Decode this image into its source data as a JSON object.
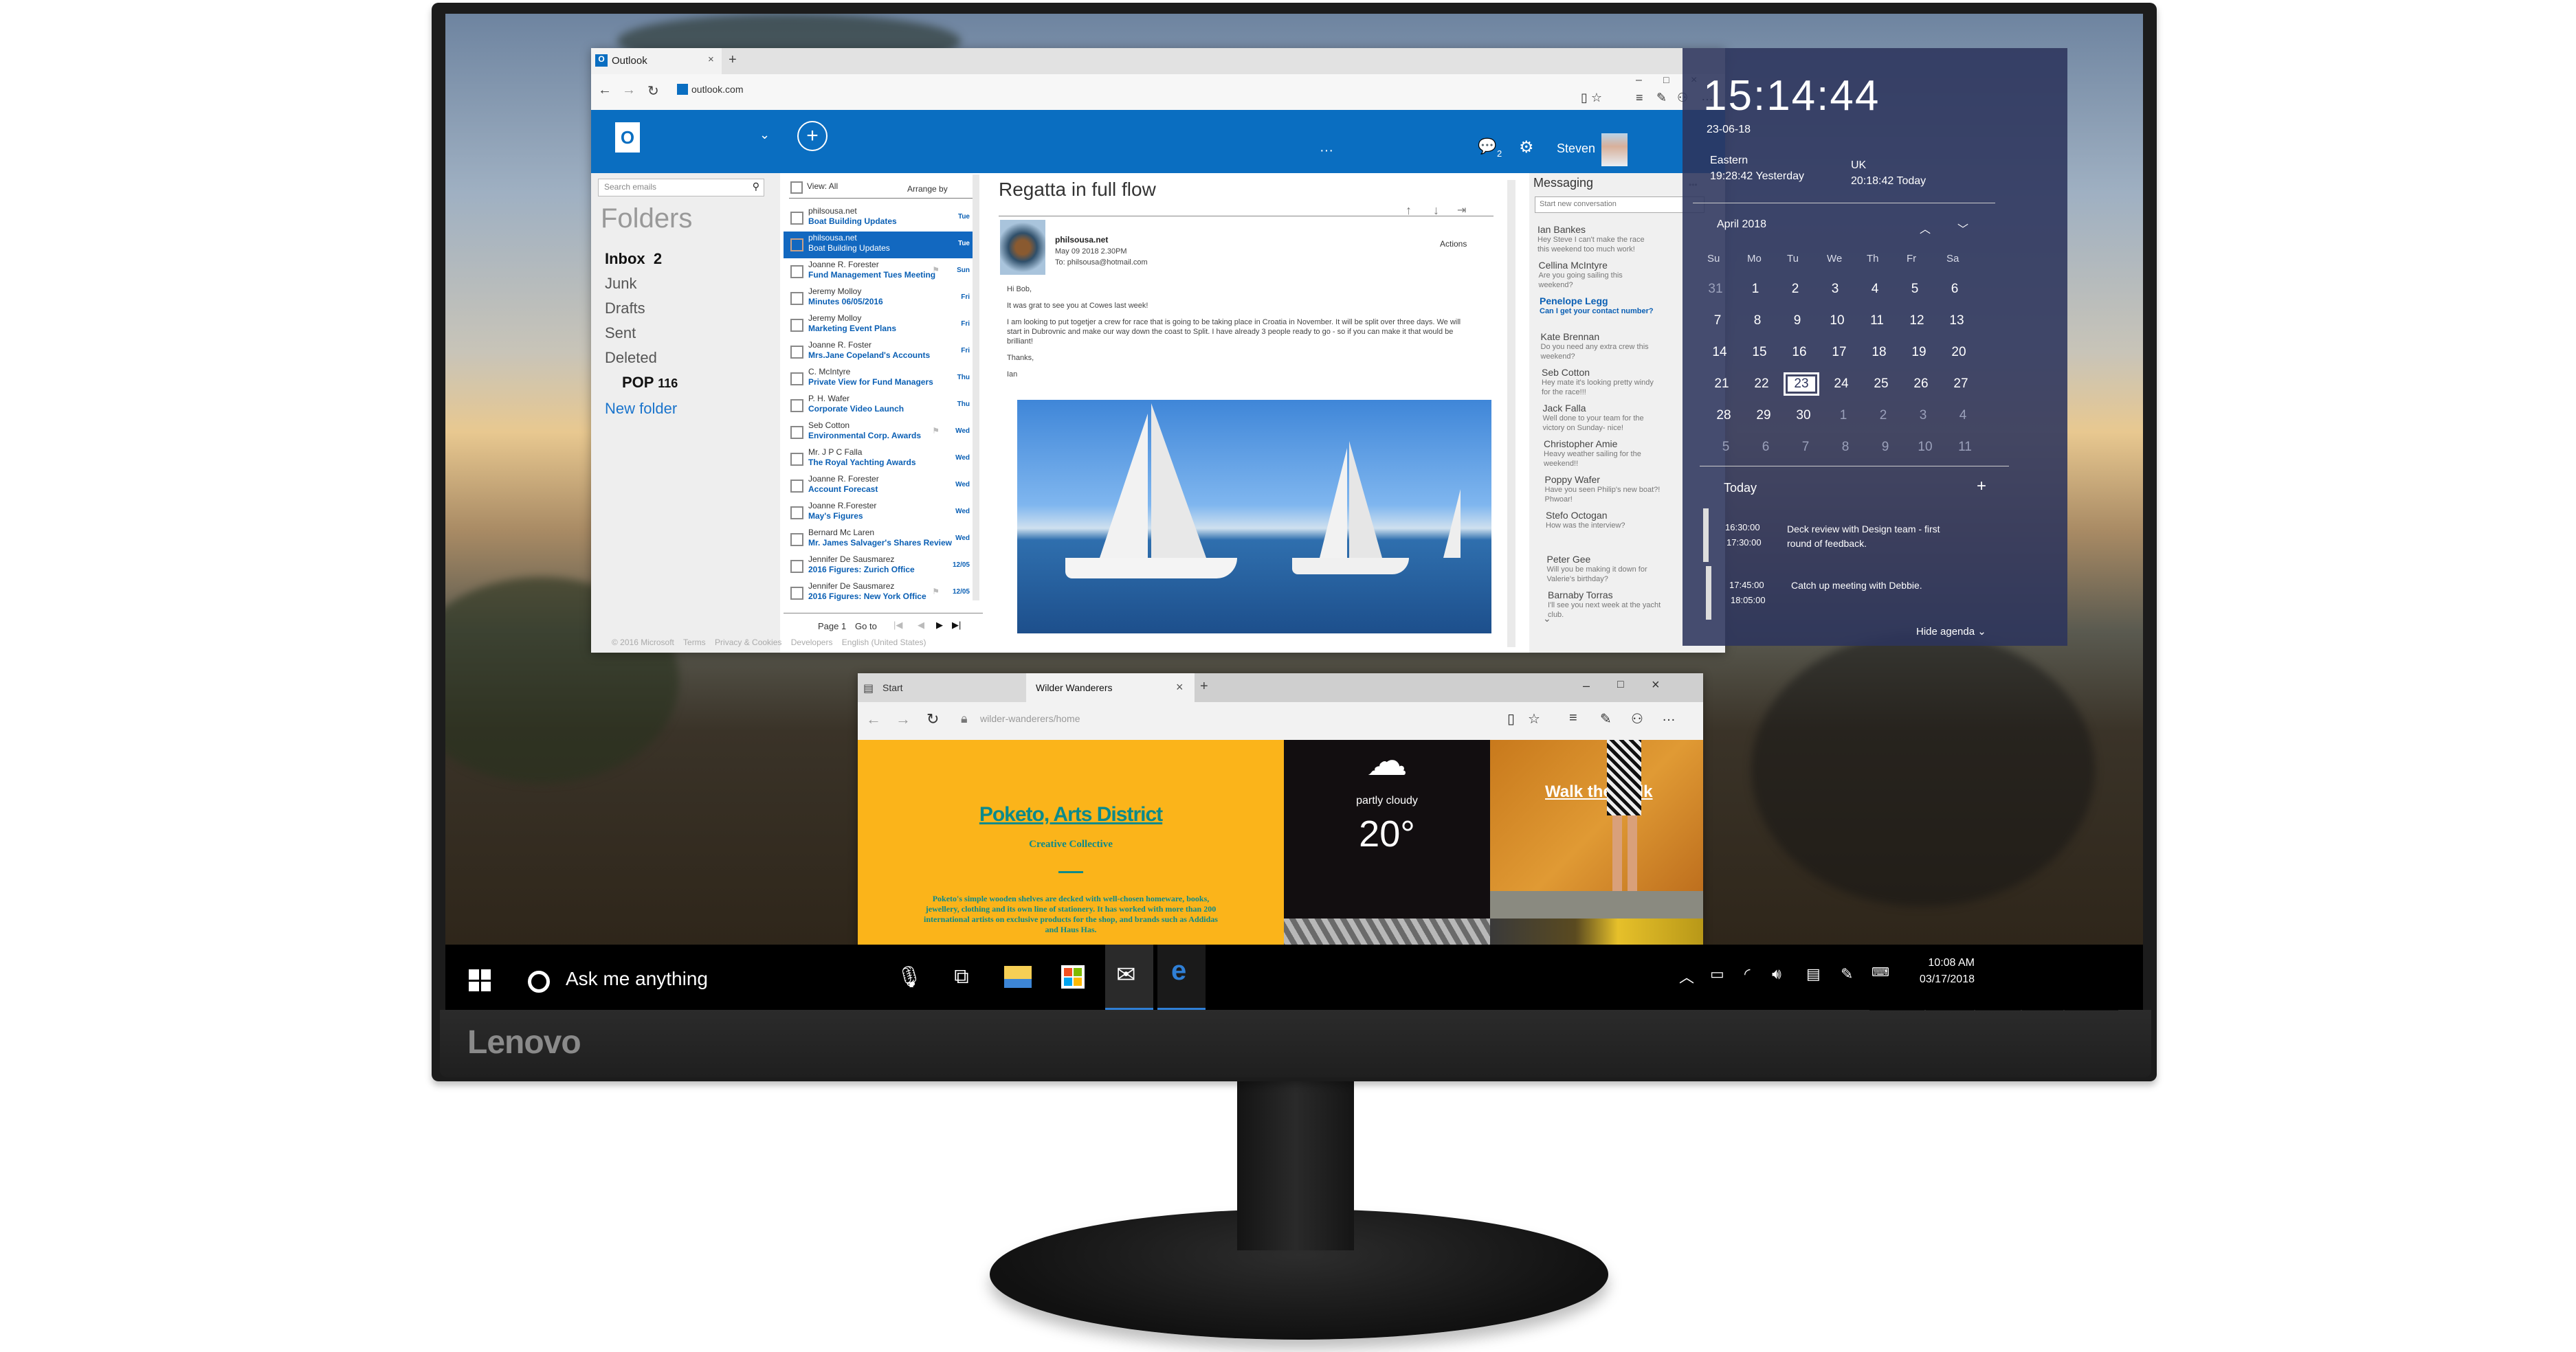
{
  "monitor": {
    "brand": "Lenovo",
    "osd_icons": [
      "input-switch-icon",
      "brightness-icon",
      "menu-icon",
      "power-icon"
    ]
  },
  "outlook": {
    "browser_tab": "Outlook",
    "tab_close": "×",
    "new_tab": "+",
    "address": "outlook.com",
    "window_controls": [
      "–",
      "□",
      "×"
    ],
    "user_name": "Steven",
    "chat_count": "2",
    "search_placeholder": "Search emails",
    "folders_title": "Folders",
    "folders": [
      {
        "label": "Inbox",
        "count": "2",
        "bold": true
      },
      {
        "label": "Junk"
      },
      {
        "label": "Drafts"
      },
      {
        "label": "Sent"
      },
      {
        "label": "Deleted"
      },
      {
        "label": "POP",
        "count": "116",
        "bold": true,
        "indent": true
      }
    ],
    "new_folder": "New folder",
    "list_header": {
      "view": "View: All",
      "arrange": "Arrange by"
    },
    "emails": [
      {
        "from": "philsousa.net",
        "subject": "Boat Building Updates",
        "day": "Tue",
        "selected": false,
        "flag": false
      },
      {
        "from": "philsousa.net",
        "subject": "Boat Building Updates",
        "day": "Tue",
        "selected": true,
        "flag": false
      },
      {
        "from": "Joanne R. Forester",
        "subject": "Fund Management Tues Meeting",
        "day": "Sun",
        "selected": false,
        "flag": true
      },
      {
        "from": "Jeremy Molloy",
        "subject": "Minutes 06/05/2016",
        "day": "Fri",
        "selected": false,
        "flag": false
      },
      {
        "from": "Jeremy Molloy",
        "subject": "Marketing Event Plans",
        "day": "Fri",
        "selected": false,
        "flag": false
      },
      {
        "from": "Joanne R. Foster",
        "subject": "Mrs.Jane Copeland's Accounts",
        "day": "Fri",
        "selected": false,
        "flag": false
      },
      {
        "from": "C. McIntyre",
        "subject": "Private View for Fund Managers",
        "day": "Thu",
        "selected": false,
        "flag": false
      },
      {
        "from": "P. H. Wafer",
        "subject": "Corporate Video Launch",
        "day": "Thu",
        "selected": false,
        "flag": false
      },
      {
        "from": "Seb Cotton",
        "subject": "Environmental Corp. Awards",
        "day": "Wed",
        "selected": false,
        "flag": true
      },
      {
        "from": "Mr. J P C Falla",
        "subject": "The Royal Yachting Awards",
        "day": "Wed",
        "selected": false,
        "flag": false
      },
      {
        "from": "Joanne R. Forester",
        "subject": "Account Forecast",
        "day": "Wed",
        "selected": false,
        "flag": false
      },
      {
        "from": "Joanne R.Forester",
        "subject": "May's Figures",
        "day": "Wed",
        "selected": false,
        "flag": false
      },
      {
        "from": "Bernard Mc Laren",
        "subject": "Mr. James Salvager's Shares Review",
        "day": "Wed",
        "selected": false,
        "flag": false
      },
      {
        "from": "Jennifer De Sausmarez",
        "subject": "2016 Figures: Zurich Office",
        "day": "12/05",
        "selected": false,
        "flag": false
      },
      {
        "from": "Jennifer De Sausmarez",
        "subject": "2016 Figures: New York Office",
        "day": "12/05",
        "selected": false,
        "flag": true
      }
    ],
    "pager": {
      "page": "Page 1",
      "goto": "Go to"
    },
    "footer": [
      "© 2016 Microsoft",
      "Terms",
      "Privacy & Cookies",
      "Developers",
      "English (United States)"
    ],
    "reading": {
      "subject": "Regatta in full flow",
      "sender": "philsousa.net",
      "date": "May 09 2018 2.30PM",
      "to": "To: philsousa@hotmail.com",
      "actions": "Actions",
      "body": [
        "Hi Bob,",
        "It was grat to see you at Cowes last week!",
        "I am looking to put togetjer a crew for race that is going to be taking place in Croatia in November. It will be split over three days. We will start in Dubrovnic and make our way down the coast to Split. I have already 3 people ready to go - so if you can make it that would be brilliant!",
        "Thanks,",
        "Ian"
      ]
    },
    "messaging": {
      "title": "Messaging",
      "more": "•••",
      "placeholder": "Start new conversation",
      "items": [
        {
          "name": "Ian Bankes",
          "text": "Hey Steve I can't make the race this weekend too much work!"
        },
        {
          "name": "Cellina McIntyre",
          "text": "Are you going sailing this weekend?"
        },
        {
          "name": "Penelope Legg",
          "text": "Can I get your contact number?",
          "highlight": true
        },
        {
          "name": "Kate Brennan",
          "text": "Do you need any extra crew this weekend?"
        },
        {
          "name": "Seb Cotton",
          "text": "Hey mate it's looking pretty windy for the race!!!"
        },
        {
          "name": "Jack Falla",
          "text": "Well done to your team for the victory on Sunday- nice!"
        },
        {
          "name": "Christopher Amie",
          "text": "Heavy weather sailing for the weekend!!"
        },
        {
          "name": "Poppy Wafer",
          "text": "Have you seen Philip's new boat?! Phwoar!"
        },
        {
          "name": "Stefo Octogan",
          "text": "How was the interview?"
        },
        {
          "name": "Peter Gee",
          "text": "Will you be making it down for Valerie's birthday?"
        },
        {
          "name": "Barnaby Torras",
          "text": "I'll see you next week at the yacht club."
        }
      ]
    }
  },
  "clock": {
    "time": "15:14:44",
    "date": "23-06-18",
    "zones": [
      {
        "name": "Eastern",
        "time": "19:28:42 Yesterday"
      },
      {
        "name": "UK",
        "time": "20:18:42 Today"
      }
    ],
    "month": "April 2018",
    "weekdays": [
      "Su",
      "Mo",
      "Tu",
      "We",
      "Th",
      "Fr",
      "Sa"
    ],
    "days": [
      [
        "31",
        "1",
        "2",
        "3",
        "4",
        "5",
        "6"
      ],
      [
        "7",
        "8",
        "9",
        "10",
        "11",
        "12",
        "13"
      ],
      [
        "14",
        "15",
        "16",
        "17",
        "18",
        "19",
        "20"
      ],
      [
        "21",
        "22",
        "23",
        "24",
        "25",
        "26",
        "27"
      ],
      [
        "28",
        "29",
        "30",
        "1",
        "2",
        "3",
        "4"
      ],
      [
        "5",
        "6",
        "7",
        "8",
        "9",
        "10",
        "11"
      ]
    ],
    "today": "23",
    "agenda_title": "Today",
    "events": [
      {
        "start": "16:30:00",
        "end": "17:30:00",
        "text": "Deck review with Design team - first round of feedback."
      },
      {
        "start": "17:45:00",
        "end": "18:05:00",
        "text": "Catch up meeting with Debbie."
      }
    ],
    "hide_agenda": "Hide agenda"
  },
  "edge": {
    "tabs": [
      {
        "label": "Start"
      },
      {
        "label": "Wilder Wanderers",
        "active": true
      }
    ],
    "new_tab": "+",
    "window_controls": [
      "–",
      "□",
      "×"
    ],
    "address": "wilder-wanderers/home",
    "page": {
      "title": "Poketo, Arts District",
      "subtitle": "Creative Collective",
      "body": "Poketo's simple wooden shelves are decked with well-chosen homeware, books, jewellery, clothing and its own line of stationery. It has worked with more than 200 international artists on exclusive products for the shop, and brands such as Addidas and Haus Has.",
      "weather_desc": "partly cloudy",
      "temperature": "20°",
      "walk": "Walk the walk"
    }
  },
  "taskbar": {
    "search_placeholder": "Ask me anything",
    "time": "10:08 AM",
    "date": "03/17/2018",
    "accent": "#2f7fd6"
  },
  "colors": {
    "outlook_blue": "#0a6ec1",
    "link_blue": "#0a5fb4",
    "poketo_yellow": "#fbb41a",
    "poketo_teal": "#0d8a8a",
    "clock_panel": "#2c345c"
  }
}
